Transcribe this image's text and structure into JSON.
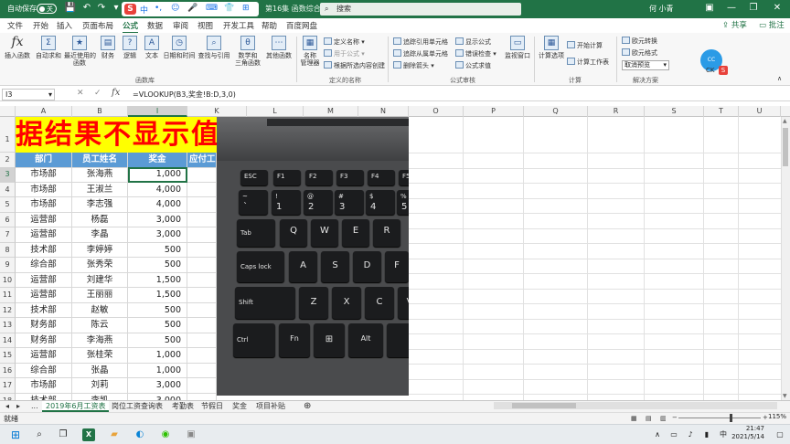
{
  "titlebar": {
    "autosave_label": "自动保存",
    "autosave_state": "关",
    "filename": "第16集 函数综合运用(1).xlsx",
    "search_placeholder": "搜索",
    "user_name": "何 小青",
    "ime": {
      "s": "S",
      "mode": "中",
      "punct": "•,",
      "emoji": "☺",
      "mic": "🎤",
      "kb": "⌨",
      "skin": "👕",
      "tool": "⊞"
    }
  },
  "ribbon_tabs": [
    "文件",
    "开始",
    "插入",
    "页面布局",
    "公式",
    "数据",
    "审阅",
    "视图",
    "开发工具",
    "帮助",
    "百度网盘"
  ],
  "active_tab": "公式",
  "share_label": "共享",
  "comment_label": "批注",
  "ribbon": {
    "function_library": {
      "insert_function": "插入函数",
      "autosum": "自动求和",
      "recent": "最近使用的\n函数",
      "financial": "财务",
      "logical": "逻辑",
      "text": "文本",
      "datetime": "日期和时间",
      "lookup": "查找与引用",
      "math": "数学和\n三角函数",
      "more": "其他函数",
      "group_label": "函数库"
    },
    "defined_names": {
      "name_manager": "名称\n管理器",
      "define_name": "定义名称",
      "use_in_formula": "用于公式",
      "create_from_selection": "根据所选内容创建",
      "group_label": "定义的名称"
    },
    "formula_auditing": {
      "trace_precedents": "追踪引用单元格",
      "trace_dependents": "追踪从属单元格",
      "remove_arrows": "删除箭头",
      "show_formulas": "显示公式",
      "error_checking": "错误检查",
      "evaluate": "公式求值",
      "watch_window": "监视窗口",
      "group_label": "公式审核"
    },
    "calculation": {
      "options": "计算选项",
      "calc_now": "开始计算",
      "calc_sheet": "计算工作表",
      "group_label": "计算"
    },
    "solutions": {
      "euro_convert": "欧元转换",
      "euro_format": "欧元格式",
      "cancel_preview": "取消预览",
      "group_label": "解决方案"
    },
    "cc_label": "CC",
    "ck_label": "CK",
    "s_badge": "S"
  },
  "formula_bar": {
    "name_box": "I3",
    "cancel": "✕",
    "enter": "✓",
    "fx": "fx",
    "formula": "=VLOOKUP(B3,奖金!B:D,3,0)"
  },
  "columns": [
    "A",
    "B",
    "I",
    "K",
    "L",
    "M",
    "N",
    "O",
    "P",
    "Q",
    "R",
    "S",
    "T",
    "U"
  ],
  "selected_column": "I",
  "selected_row": "3",
  "banner_text": "据结果不显示值怎",
  "table": {
    "headers": [
      "部门",
      "员工姓名",
      "奖金",
      "应付工"
    ],
    "rows": [
      {
        "row": "3",
        "dept": "市场部",
        "name": "张海燕",
        "bonus": "1,000"
      },
      {
        "row": "4",
        "dept": "市场部",
        "name": "王淑兰",
        "bonus": "4,000"
      },
      {
        "row": "5",
        "dept": "市场部",
        "name": "李志强",
        "bonus": "4,000"
      },
      {
        "row": "6",
        "dept": "运营部",
        "name": "杨磊",
        "bonus": "3,000"
      },
      {
        "row": "7",
        "dept": "运营部",
        "name": "李晶",
        "bonus": "3,000"
      },
      {
        "row": "8",
        "dept": "技术部",
        "name": "李婷婷",
        "bonus": "500"
      },
      {
        "row": "9",
        "dept": "综合部",
        "name": "张秀荣",
        "bonus": "500"
      },
      {
        "row": "10",
        "dept": "运营部",
        "name": "刘建华",
        "bonus": "1,500"
      },
      {
        "row": "11",
        "dept": "运营部",
        "name": "王丽丽",
        "bonus": "1,500"
      },
      {
        "row": "12",
        "dept": "技术部",
        "name": "赵敏",
        "bonus": "500"
      },
      {
        "row": "13",
        "dept": "财务部",
        "name": "陈云",
        "bonus": "500"
      },
      {
        "row": "14",
        "dept": "财务部",
        "name": "李海燕",
        "bonus": "500"
      },
      {
        "row": "15",
        "dept": "运营部",
        "name": "张桂荣",
        "bonus": "1,000"
      },
      {
        "row": "16",
        "dept": "综合部",
        "name": "张晶",
        "bonus": "1,000"
      },
      {
        "row": "17",
        "dept": "市场部",
        "name": "刘莉",
        "bonus": "3,000"
      },
      {
        "row": "18",
        "dept": "技术部",
        "name": "李凯",
        "bonus": "3,000"
      },
      {
        "row": "19",
        "dept": "技术部",
        "name": "张玉",
        "bonus": "1,000"
      }
    ]
  },
  "keyboard_keys": {
    "esc": "ESC",
    "f1": "F1",
    "f2": "F2",
    "f3": "F3",
    "f4": "F4",
    "f5": "F5",
    "tilde": "~",
    "tilde_low": "`",
    "k1": "!",
    "k1_low": "1",
    "k2": "@",
    "k2_low": "2",
    "k3": "#",
    "k3_low": "3",
    "k4": "$",
    "k4_low": "4",
    "k5": "%",
    "k5_low": "5",
    "tab": "Tab",
    "q": "Q",
    "w": "W",
    "e": "E",
    "r": "R",
    "caps": "Caps lock",
    "a": "A",
    "s": "S",
    "d": "D",
    "f": "F",
    "shift": "Shift",
    "z": "Z",
    "x": "X",
    "c": "C",
    "v": "V",
    "ctrl": "Ctrl",
    "fn": "Fn",
    "win": "⊞",
    "alt": "Alt"
  },
  "sheet_tabs": [
    "2019年6月工资表",
    "岗位工资查询表",
    "考勤表",
    "节假日",
    "奖金",
    "项目补贴"
  ],
  "active_sheet": "2019年6月工资表",
  "sheet_ellipsis": "...",
  "add_sheet": "⊕",
  "status": {
    "ready": "就绪",
    "zoom": "115%"
  },
  "taskbar": {
    "time": "21:47",
    "date": "2021/5/14",
    "xl": "X"
  }
}
